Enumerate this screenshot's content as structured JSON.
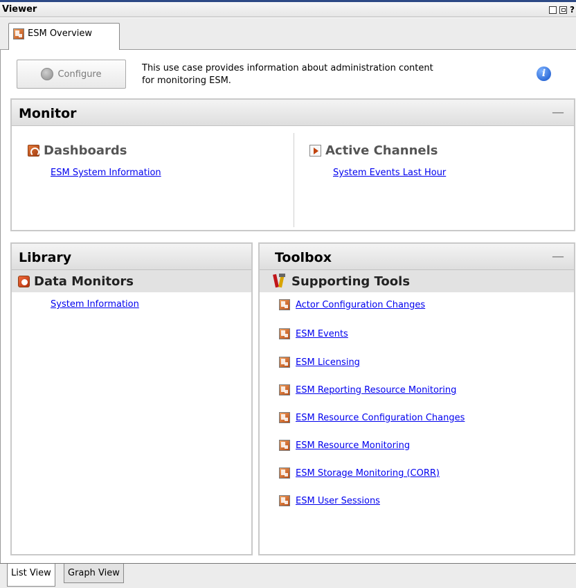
{
  "viewer": {
    "title": "Viewer",
    "help": "?"
  },
  "tab": {
    "label": "ESM Overview"
  },
  "header": {
    "configure_label": "Configure",
    "description_line1": "This use case provides information about administration content",
    "description_line2": "for monitoring ESM.",
    "info": "i"
  },
  "monitor": {
    "title": "Monitor",
    "collapse": "—",
    "dashboards": {
      "title": "Dashboards",
      "items": [
        "ESM System Information"
      ]
    },
    "active_channels": {
      "title": "Active Channels",
      "items": [
        "System Events Last Hour"
      ]
    }
  },
  "library": {
    "title": "Library",
    "data_monitors": {
      "title": "Data Monitors",
      "items": [
        "System Information"
      ]
    }
  },
  "toolbox": {
    "title": "Toolbox",
    "collapse": "—",
    "supporting_tools": {
      "title": "Supporting Tools",
      "items": [
        "Actor Configuration Changes",
        "ESM Events",
        "ESM Licensing",
        "ESM Reporting Resource Monitoring",
        "ESM Resource Configuration Changes",
        "ESM Resource Monitoring",
        "ESM Storage Monitoring (CORR)",
        "ESM User Sessions"
      ]
    }
  },
  "bottom_tabs": [
    "List View",
    "Graph View"
  ]
}
